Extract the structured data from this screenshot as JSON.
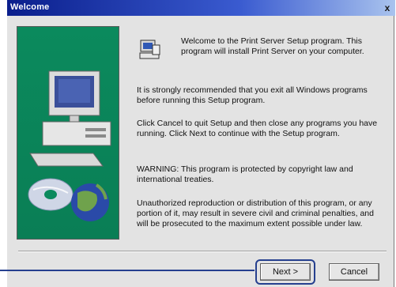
{
  "window": {
    "title": "Welcome",
    "close_glyph": "x"
  },
  "content": {
    "welcome": "Welcome to the Print Server Setup program. This program will install Print Server on your computer.",
    "para1": "It is strongly recommended that you exit all Windows programs before running this Setup program.",
    "para2": "Click Cancel to quit Setup and then close any programs you have running. Click Next to continue with the Setup program.",
    "para3": "WARNING: This program is protected by copyright law and international treaties.",
    "para4": "Unauthorized reproduction or distribution of this program, or any portion of it, may result in severe civil and criminal penalties, and will be prosecuted to the maximum extent possible under law."
  },
  "buttons": {
    "next": "Next >",
    "cancel": "Cancel"
  },
  "colors": {
    "panel_green": "#0b8a5d",
    "titlebar_blue": "#0a1e8c",
    "highlight": "#26408f"
  },
  "icons": [
    "setup-computer-icon",
    "close-icon",
    "computer-illustration",
    "cd-disc-illustration",
    "globe-illustration"
  ]
}
